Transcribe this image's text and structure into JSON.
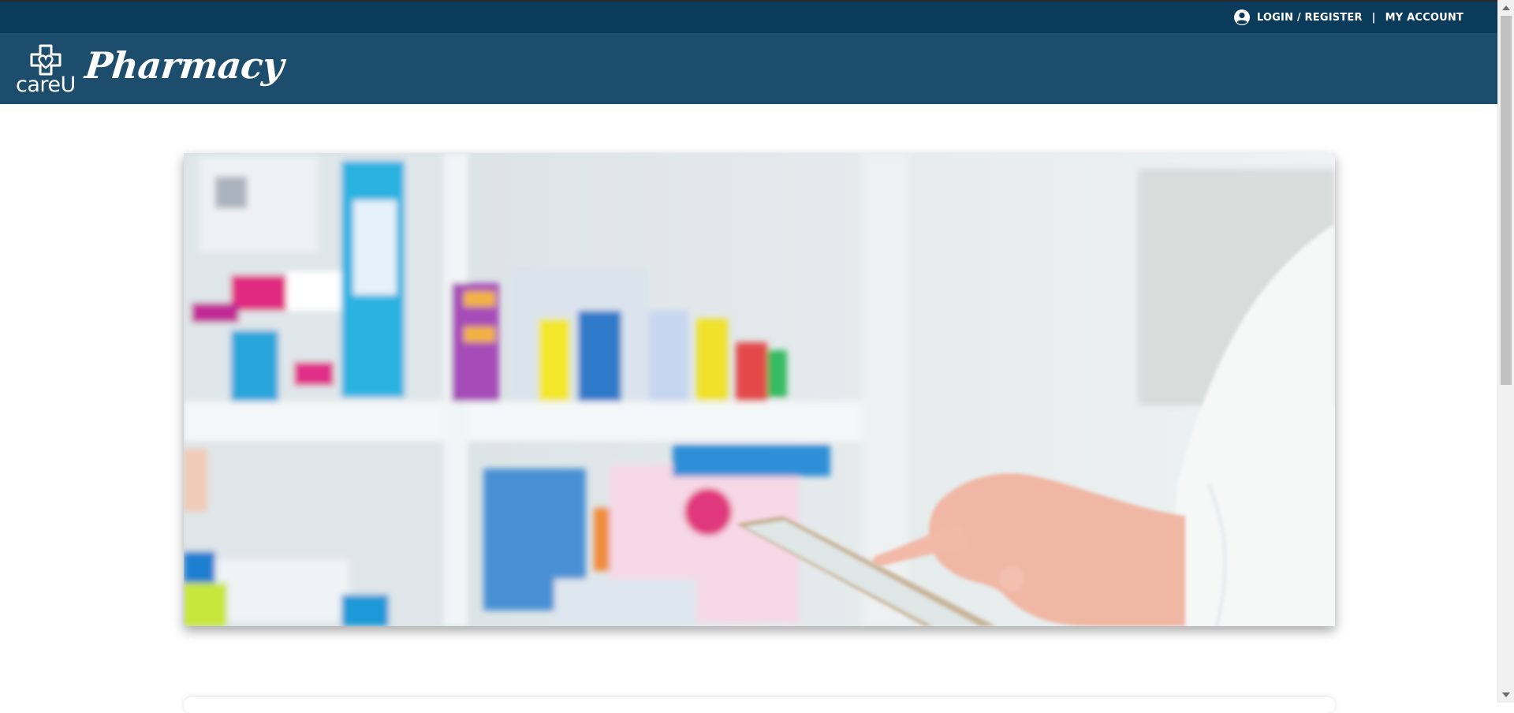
{
  "topbar": {
    "user_icon": "user-circle-icon",
    "login_label": "LOGIN / REGISTER",
    "separator": "|",
    "account_label": "MY ACCOUNT"
  },
  "header": {
    "logo_icon": "heart-cross-icon",
    "logo_text": "careU",
    "pharmacy_text": "Pharmacy"
  },
  "hero": {
    "image": "pharmacist-tablet-shelves-photo"
  },
  "colors": {
    "topbar": "#0b3b5a",
    "header": "#1d4d6d",
    "background": "#ffffff"
  }
}
